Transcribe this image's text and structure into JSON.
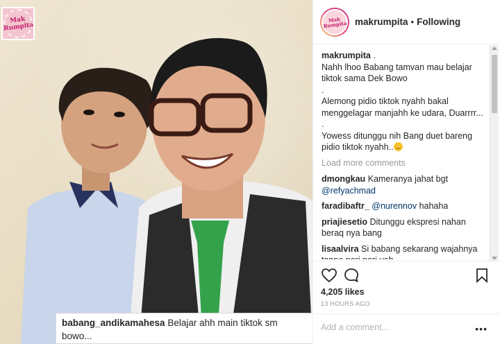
{
  "post": {
    "account": "makrumpita",
    "separator": "•",
    "follow_status": "Following",
    "watermark_text": "Mak Rumpita",
    "overlay_caption": {
      "user": "babang_andikamahesa",
      "text": "Belajar ahh main tiktok sm bowo..."
    },
    "caption": {
      "user": "makrumpita",
      "lines": [
        ".",
        "Nahh lhoo Babang tamvan mau belajar tiktok sama Dek Bowo",
        ".",
        "Alemong pidio tiktok nyahh bakal menggelagar manjahh ke udara, Duarrrr...",
        ".",
        "Yowess ditunggu nih Bang duet bareng pidio tiktok nyahh.."
      ]
    },
    "load_more": "Load more comments",
    "comments": [
      {
        "user": "dmongkau",
        "text": "Kameranya jahat bgt",
        "mention": "@refyachmad"
      },
      {
        "user": "faradibaftr_",
        "mention": "@nurennov",
        "text": "hahaha"
      },
      {
        "user": "priajiesetio",
        "text": "Ditunggu ekspresi nahan beraq nya bang"
      },
      {
        "user": "lisaalvira",
        "text": "Si babang sekarang wajahnya tanpa pori pori yah"
      }
    ],
    "likes": "4,205 likes",
    "time": "13 HOURS AGO",
    "add_comment_placeholder": "Add a comment...",
    "more_options": "•••",
    "icons": {
      "like": "heart-icon",
      "comment": "comment-bubble-icon",
      "save": "bookmark-icon"
    },
    "colors": {
      "text": "#262626",
      "muted": "#999999",
      "mention": "#003569",
      "border": "#efefef"
    }
  }
}
